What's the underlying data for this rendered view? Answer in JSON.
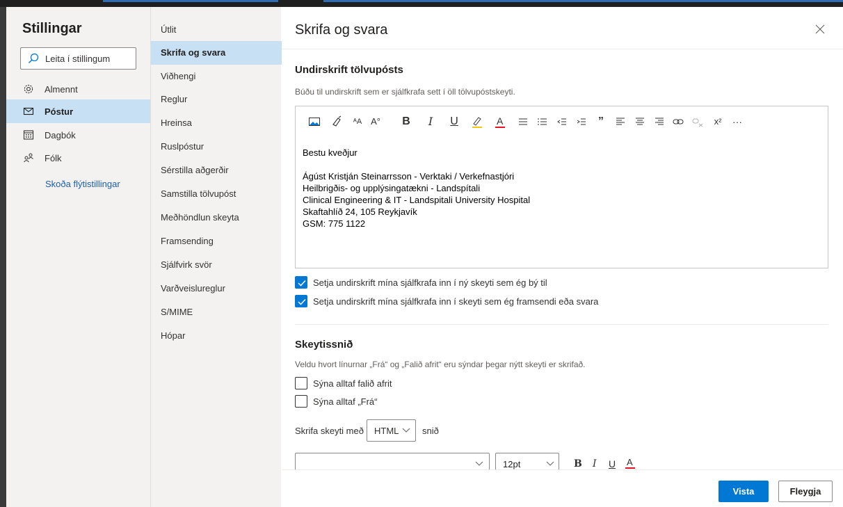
{
  "settings": {
    "title": "Stillingar",
    "search_placeholder": "Leita í stillingum",
    "categories": [
      {
        "label": "Almennt",
        "icon": "gear-icon"
      },
      {
        "label": "Póstur",
        "icon": "mail-icon",
        "active": true
      },
      {
        "label": "Dagbók",
        "icon": "calendar-icon"
      },
      {
        "label": "Fólk",
        "icon": "people-icon"
      }
    ],
    "quick_settings": "Skoða flýtistillingar"
  },
  "subnav": {
    "items": [
      "Útlit",
      "Skrifa og svara",
      "Viðhengi",
      "Reglur",
      "Hreinsa",
      "Ruslpóstur",
      "Sérstilla aðgerðir",
      "Samstilla tölvupóst",
      "Meðhöndlun skeyta",
      "Framsending",
      "Sjálfvirk svör",
      "Varðveislureglur",
      "S/MIME",
      "Hópar"
    ],
    "active_index": 1
  },
  "content": {
    "title": "Skrifa og svara",
    "signature": {
      "heading": "Undirskrift tölvupósts",
      "description": "Búðu til undirskrift sem er sjálfkrafa sett í öll tölvupóstskeyti.",
      "lines": [
        "Bestu kveðjur",
        "",
        "Ágúst Kristján Steinarrsson - Verktaki / Verkefnastjóri",
        "Heilbrigðis- og upplýsingatækni - Landspítali",
        "Clinical Engineering & IT - Landspitali University Hospital",
        "Skaftahlíð 24, 105 Reykjavík",
        "GSM: 775 1122"
      ],
      "checkbox_new": "Setja undirskrift mína sjálfkrafa inn í ný skeyti sem ég bý til",
      "checkbox_new_checked": true,
      "checkbox_reply": "Setja undirskrift mína sjálfkrafa inn í skeyti sem ég framsendi eða svara",
      "checkbox_reply_checked": true
    },
    "message_format": {
      "heading": "Skeytissnið",
      "description": "Veldu hvort línurnar „Frá“ og „Falið afrit“ eru sýndar þegar nýtt skeyti er skrifað.",
      "checkbox_bcc": "Sýna alltaf falið afrit",
      "checkbox_bcc_checked": false,
      "checkbox_from": "Sýna alltaf „Frá“",
      "checkbox_from_checked": false,
      "compose_prefix": "Skrifa skeyti með",
      "compose_format": "HTML",
      "compose_suffix": "snið",
      "font_name": "",
      "font_size": "12pt"
    },
    "buttons": {
      "save": "Vista",
      "discard": "Fleygja"
    }
  },
  "colors": {
    "accent": "#0078d4",
    "nav_selected": "#c7e0f4",
    "link": "#1b5fab"
  }
}
